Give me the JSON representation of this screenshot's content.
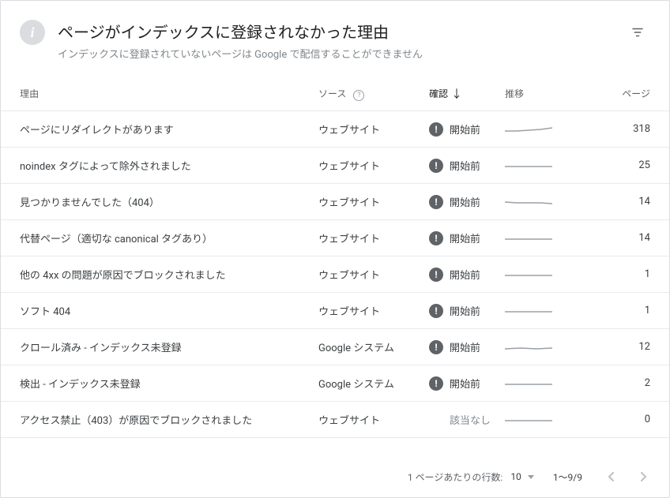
{
  "header": {
    "title": "ページがインデックスに登録されなかった理由",
    "subtitle": "インデックスに登録されていないページは Google で配信することができません"
  },
  "columns": {
    "reason": "理由",
    "source": "ソース",
    "confirm": "確認",
    "trend": "推移",
    "pages": "ページ"
  },
  "rows": [
    {
      "reason": "ページにリダイレクトがあります",
      "source": "ウェブサイト",
      "confirm": "開始前",
      "pages": "318",
      "badge": true
    },
    {
      "reason": "noindex タグによって除外されました",
      "source": "ウェブサイト",
      "confirm": "開始前",
      "pages": "25",
      "badge": true
    },
    {
      "reason": "見つかりませんでした（404）",
      "source": "ウェブサイト",
      "confirm": "開始前",
      "pages": "14",
      "badge": true
    },
    {
      "reason": "代替ページ（適切な canonical タグあり）",
      "source": "ウェブサイト",
      "confirm": "開始前",
      "pages": "14",
      "badge": true
    },
    {
      "reason": "他の 4xx の問題が原因でブロックされました",
      "source": "ウェブサイト",
      "confirm": "開始前",
      "pages": "1",
      "badge": true
    },
    {
      "reason": "ソフト 404",
      "source": "ウェブサイト",
      "confirm": "開始前",
      "pages": "1",
      "badge": true
    },
    {
      "reason": "クロール済み - インデックス未登録",
      "source": "Google システム",
      "confirm": "開始前",
      "pages": "12",
      "badge": true
    },
    {
      "reason": "検出 - インデックス未登録",
      "source": "Google システム",
      "confirm": "開始前",
      "pages": "2",
      "badge": true
    },
    {
      "reason": "アクセス禁止（403）が原因でブロックされました",
      "source": "ウェブサイト",
      "confirm": "該当なし",
      "pages": "0",
      "badge": false
    }
  ],
  "footer": {
    "rows_label": "1 ページあたりの行数:",
    "rows_value": "10",
    "range": "1～9/9"
  }
}
